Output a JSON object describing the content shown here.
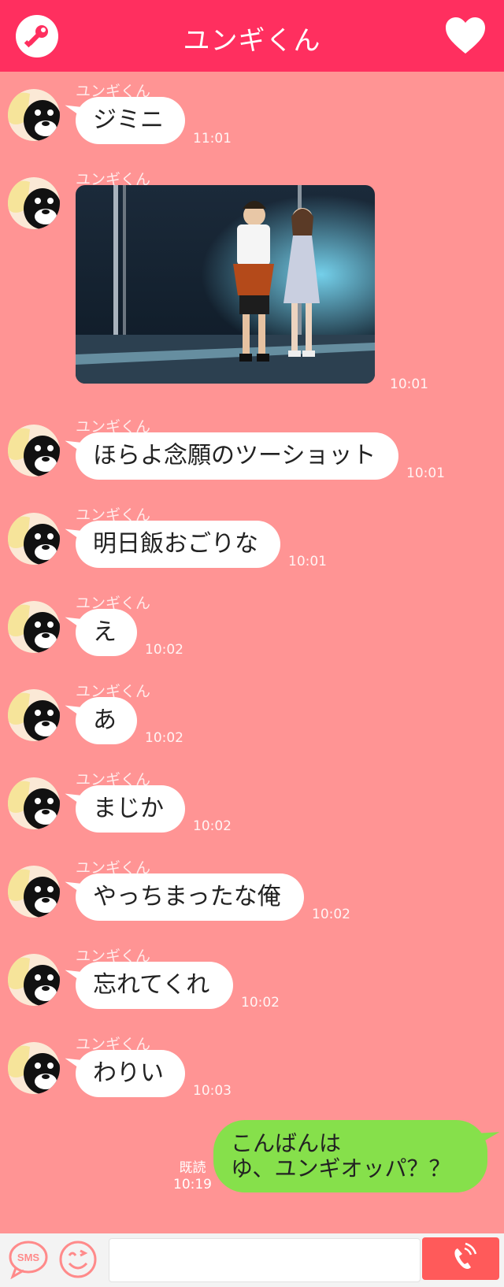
{
  "header": {
    "title": "ユンギくん",
    "left_icon": "key-icon",
    "right_icon": "heart-icon"
  },
  "sender_name": "ユンギくん",
  "messages": [
    {
      "type": "text",
      "sender": "ユンギくん",
      "text": "ジミニ",
      "time": "11:01"
    },
    {
      "type": "image",
      "sender": "ユンギくん",
      "time": "10:01",
      "image_desc": "stage photo"
    },
    {
      "type": "text",
      "sender": "ユンギくん",
      "text": "ほらよ念願のツーショット",
      "time": "10:01"
    },
    {
      "type": "text",
      "sender": "ユンギくん",
      "text": "明日飯おごりな",
      "time": "10:01"
    },
    {
      "type": "text",
      "sender": "ユンギくん",
      "text": "え",
      "time": "10:02"
    },
    {
      "type": "text",
      "sender": "ユンギくん",
      "text": "あ",
      "time": "10:02"
    },
    {
      "type": "text",
      "sender": "ユンギくん",
      "text": "まじか",
      "time": "10:02"
    },
    {
      "type": "text",
      "sender": "ユンギくん",
      "text": "やっちまったな俺",
      "time": "10:02"
    },
    {
      "type": "text",
      "sender": "ユンギくん",
      "text": "忘れてくれ",
      "time": "10:02"
    },
    {
      "type": "text",
      "sender": "ユンギくん",
      "text": "わりい",
      "time": "10:03"
    }
  ],
  "outgoing": {
    "line1": "こんばんは",
    "line2": "ゆ、ユンギオッパ？？",
    "read_label": "既読",
    "time": "10:19"
  },
  "footer": {
    "sms_label": "SMS",
    "input_value": "",
    "input_placeholder": "",
    "icons": [
      "sms-icon",
      "smiley-icon",
      "phone-icon"
    ]
  },
  "colors": {
    "header": "#ff2f5f",
    "background": "#ff9494",
    "outgoing_bubble": "#86e04b",
    "call_button": "#ff5a5a"
  }
}
